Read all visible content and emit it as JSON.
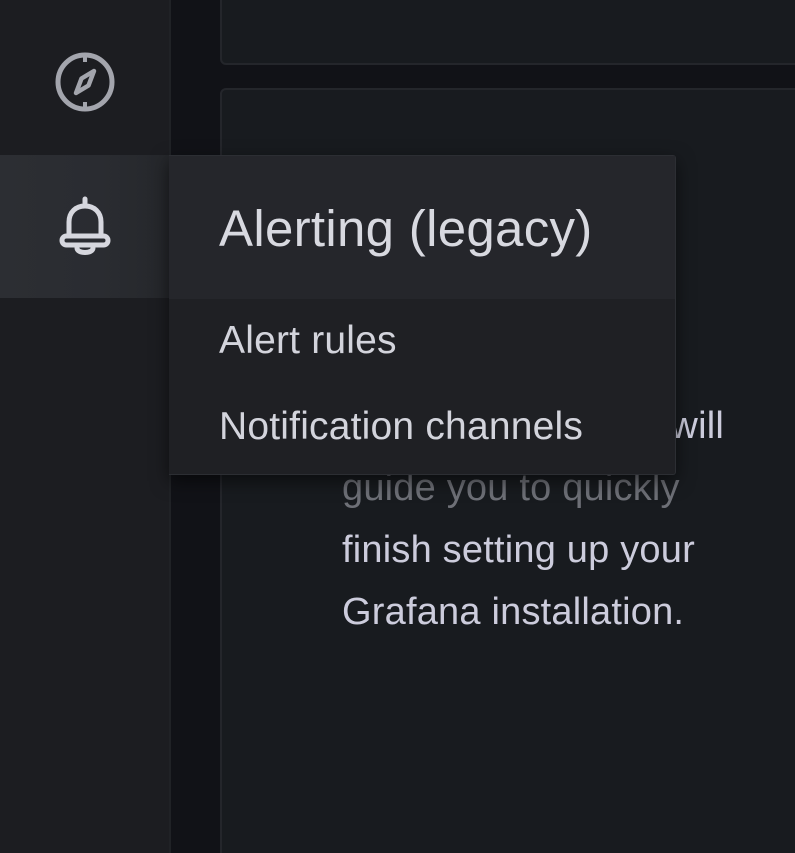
{
  "sidebar": {
    "items": [
      {
        "name": "explore",
        "icon": "compass-icon"
      },
      {
        "name": "alerting",
        "icon": "bell-icon",
        "active": true
      }
    ]
  },
  "menu": {
    "title": "Alerting (legacy)",
    "items": [
      {
        "label": "Alert rules"
      },
      {
        "label": "Notification channels"
      }
    ]
  },
  "panel": {
    "text_line1_tail": "will",
    "text_line2": "guide you to quickly",
    "text_line3": "finish setting up your",
    "text_line4": "Grafana installation."
  },
  "colors": {
    "background": "#111217",
    "sidebar": "#1c1d21",
    "menu_header": "#25262b",
    "menu_body": "#1f2024",
    "text": "#ccccdc",
    "icon": "#a3a5ad"
  }
}
